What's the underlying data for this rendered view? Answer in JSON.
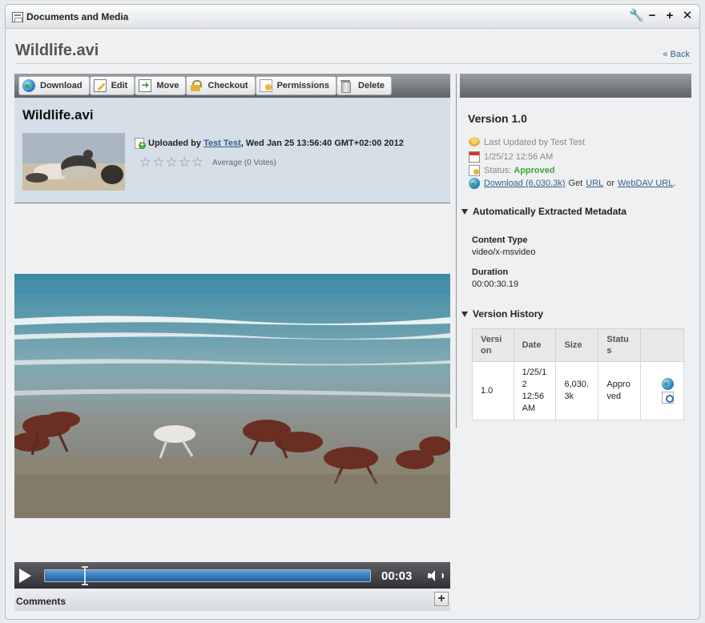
{
  "portlet": {
    "title": "Documents and Media",
    "controls": {
      "config": "🔧",
      "minimize": "−",
      "maximize": "+",
      "close": "✕"
    }
  },
  "page": {
    "title": "Wildlife.avi",
    "back_label": "« Back"
  },
  "toolbar": {
    "download": "Download",
    "edit": "Edit",
    "move": "Move",
    "checkout": "Checkout",
    "permissions": "Permissions",
    "delete": "Delete"
  },
  "document": {
    "title": "Wildlife.avi",
    "uploaded_prefix": "Uploaded by",
    "uploader": "Test Test",
    "uploaded_date": ", Wed Jan 25 13:56:40 GMT+02:00 2012",
    "rating_stars": 0,
    "rating_max": 5,
    "rating_text": "Average (0 Votes)"
  },
  "player": {
    "time": "00:03",
    "progress": 0.12
  },
  "comments": {
    "label": "Comments",
    "add": "+"
  },
  "version_panel": {
    "title": "Version 1.0",
    "last_updated": "Last Updated by Test Test",
    "date": "1/25/12 12:56 AM",
    "status_label": "Status:",
    "status_value": "Approved",
    "download_link": "Download (6,030.3k)",
    "get_text": "Get",
    "url_link": "URL",
    "or_text": "or",
    "webdav_link": "WebDAV URL",
    "period": "."
  },
  "metadata": {
    "title": "Automatically Extracted Metadata",
    "content_type_label": "Content Type",
    "content_type_value": "video/x-msvideo",
    "duration_label": "Duration",
    "duration_value": "00:00:30.19"
  },
  "history": {
    "title": "Version History",
    "columns": [
      "Versi on",
      "Date",
      "Size",
      "Statu s",
      ""
    ],
    "rows": [
      {
        "version": "1.0",
        "date": "1/25/1 2 12:56 AM",
        "size": "6,030. 3k",
        "status": "Appro ved"
      }
    ]
  },
  "colors": {
    "toolbar_dark": "#5f6368",
    "link": "#3a5f8d",
    "approved": "#47a039",
    "doc_card_bg": "#d6dee7"
  }
}
